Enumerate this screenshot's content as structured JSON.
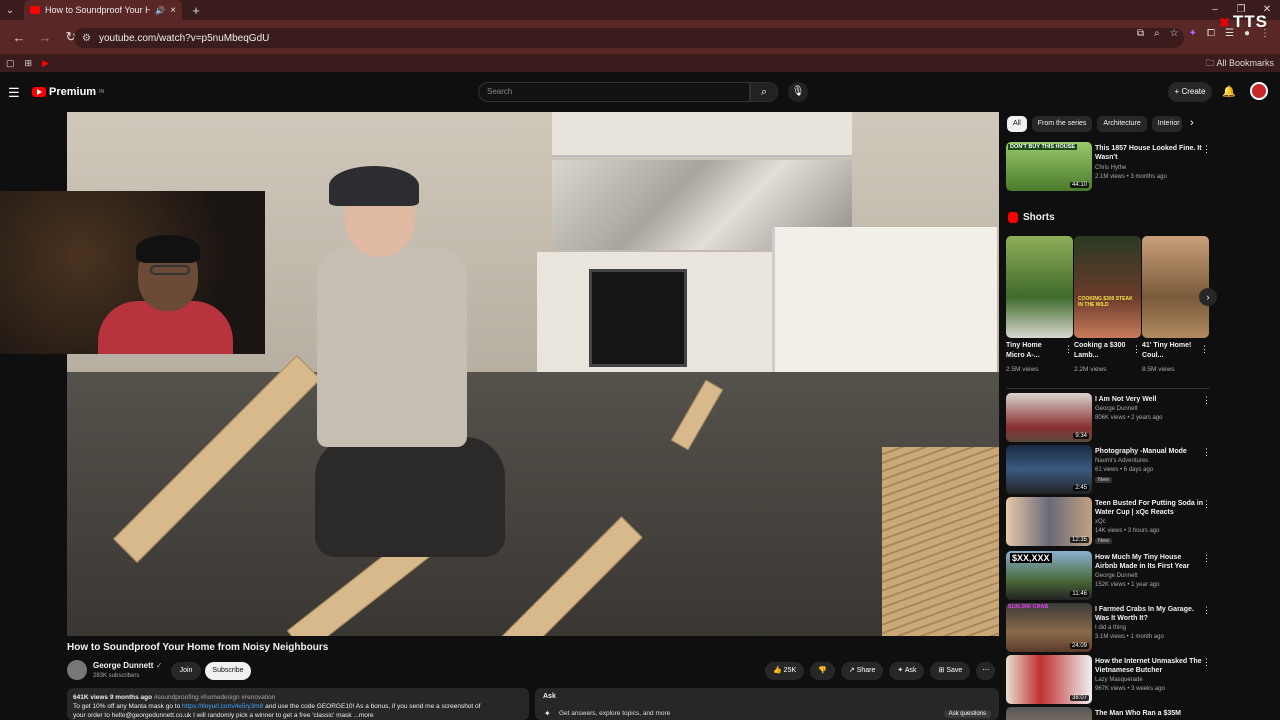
{
  "browser": {
    "tab_title": "How to Soundproof Your H",
    "tab_close": "×",
    "new_tab": "+",
    "url": "youtube.com/watch?v=p5nuMbeqGdU",
    "bookmarks_label": "All Bookmarks",
    "overlay_logo": "TTS"
  },
  "header": {
    "logo_text": "Premium",
    "logo_sup": "IN",
    "search_placeholder": "Search",
    "create_label": "+ Create"
  },
  "video": {
    "title": "How to Soundproof Your Home from Noisy Neighbours",
    "channel": "George Dunnett",
    "subscribers": "283K subscribers",
    "join_label": "Join",
    "subscribe_label": "Subscribe",
    "likes": "25K",
    "share_label": "Share",
    "ask_label": "Ask",
    "save_label": "Save"
  },
  "description": {
    "meta": "641K views  9 months ago",
    "hashtags": "#soundproofing #homedesign #renovation",
    "line1_a": "To get 10% off any Manta mask go to",
    "link": "https://tinyurl.com/4x5ry3m8",
    "line1_b": "and use the code GEORGE10! As a bonus, if you send me a screenshot of",
    "line2": "your order to hello@georgedunnett.co.uk I will randomly pick a winner to get a free 'classic' mask ...more"
  },
  "ask_panel": {
    "heading": "Ask",
    "subtitle": "Get answers, explore topics, and more",
    "button": "Ask questions"
  },
  "chips": [
    "All",
    "From the series",
    "Architecture",
    "Interior"
  ],
  "top_rec": {
    "title": "This 1857 House Looked Fine. It Wasn't",
    "channel": "Chris Hythe",
    "meta": "2.1M views • 3 months ago",
    "duration": "44:10",
    "thumb_text": "DON'T BUY THIS HOUSE"
  },
  "shorts": {
    "heading": "Shorts",
    "items": [
      {
        "title": "Tiny Home Micro A-...",
        "views": "2.5M views"
      },
      {
        "title": "Cooking a $300 Lamb...",
        "views": "2.2M views",
        "thumb_text": "COOKING $300 STEAK IN THE WILD"
      },
      {
        "title": "41' Tiny Home! Coul...",
        "views": "8.5M views"
      }
    ]
  },
  "recs": [
    {
      "title": "I Am Not Very Well",
      "channel": "George Dunnett",
      "meta": "806K views • 2 years ago",
      "duration": "9:34"
    },
    {
      "title": "Photography -Manual Mode",
      "channel": "Naomi's Adventures",
      "meta": "61 views • 6 days ago",
      "duration": "2:45",
      "badge": "New"
    },
    {
      "title": "Teen Busted For Putting Soda in Water Cup | xQc Reacts",
      "channel": "xQc",
      "meta": "14K views • 3 hours ago",
      "duration": "12:35",
      "badge": "New"
    },
    {
      "title": "How Much My Tiny House Airbnb Made in Its First Year",
      "channel": "George Dunnett",
      "meta": "152K views • 1 year ago",
      "duration": "11:46",
      "thumb_text": "$XX,XXX"
    },
    {
      "title": "I Farmed Crabs In My Garage. Was It Worth It?",
      "channel": "I did a thing",
      "meta": "3.1M views • 1 month ago",
      "duration": "24:09",
      "thumb_text": "$100,000 CRAB"
    },
    {
      "title": "How the Internet Unmasked The Vietnamese Butcher",
      "channel": "Lazy Masquerade",
      "meta": "967K views • 3 weeks ago",
      "duration": "38:07"
    },
    {
      "title": "The Man Who Ran a $35M",
      "channel": "",
      "meta": "",
      "duration": ""
    }
  ]
}
